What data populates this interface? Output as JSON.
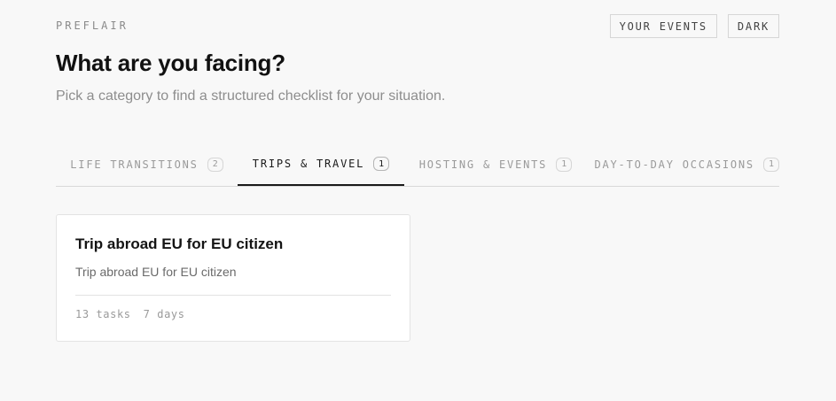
{
  "header": {
    "brand": "PREFLAIR",
    "your_events_label": "YOUR EVENTS",
    "theme_toggle_label": "DARK"
  },
  "main": {
    "title": "What are you facing?",
    "subtitle": "Pick a category to find a structured checklist for your situation."
  },
  "tabs": [
    {
      "label": "LIFE TRANSITIONS",
      "count": "2",
      "active": false
    },
    {
      "label": "TRIPS & TRAVEL",
      "count": "1",
      "active": true
    },
    {
      "label": "HOSTING & EVENTS",
      "count": "1",
      "active": false
    },
    {
      "label": "DAY-TO-DAY OCCASIONS",
      "count": "1",
      "active": false
    }
  ],
  "cards": [
    {
      "title": "Trip abroad EU for EU citizen",
      "description": "Trip abroad EU for EU citizen",
      "tasks": "13 tasks",
      "duration": "7 days"
    }
  ]
}
